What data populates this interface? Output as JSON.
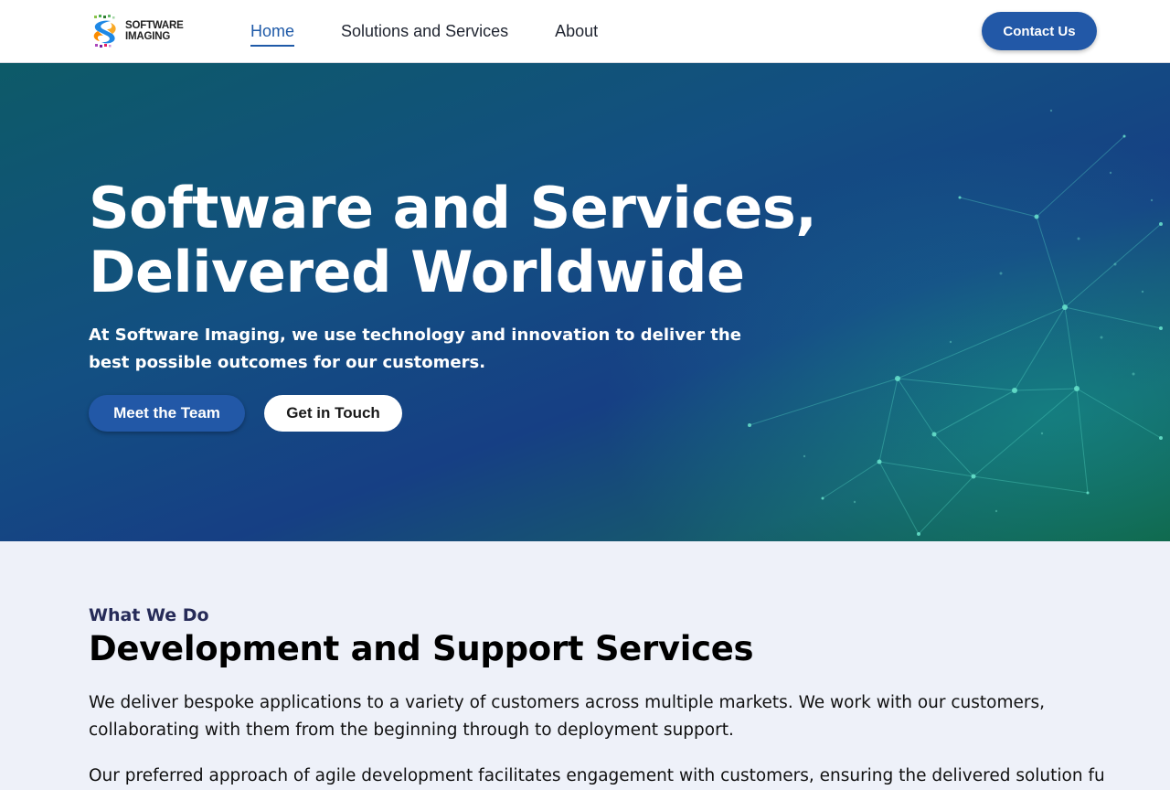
{
  "header": {
    "logo": {
      "line1": "SOFTWARE",
      "line2": "IMAGING",
      "mark": "software-imaging-logo-mark"
    },
    "nav": [
      {
        "label": "Home",
        "active": true
      },
      {
        "label": "Solutions and Services",
        "active": false
      },
      {
        "label": "About",
        "active": false
      }
    ],
    "contact_label": "Contact Us"
  },
  "hero": {
    "title_line1": "Software and Services,",
    "title_line2": "Delivered Worldwide",
    "subtitle": "At Software Imaging, we use technology and innovation to deliver the best possible outcomes for our customers.",
    "primary_button": "Meet the Team",
    "secondary_button": "Get in Touch"
  },
  "what_we_do": {
    "eyebrow": "What We Do",
    "title": "Development and Support Services",
    "paragraph1": "We deliver bespoke applications to a variety of customers across multiple markets. We work with our customers, collaborating with them from the beginning through to deployment support.",
    "paragraph2": "Our preferred approach of agile development facilitates engagement with customers, ensuring the delivered solution fully"
  },
  "colors": {
    "accent_blue": "#2258a7",
    "nav_active": "#1f5aa8",
    "eyebrow": "#262b58",
    "section_bg": "#eef1f9"
  }
}
